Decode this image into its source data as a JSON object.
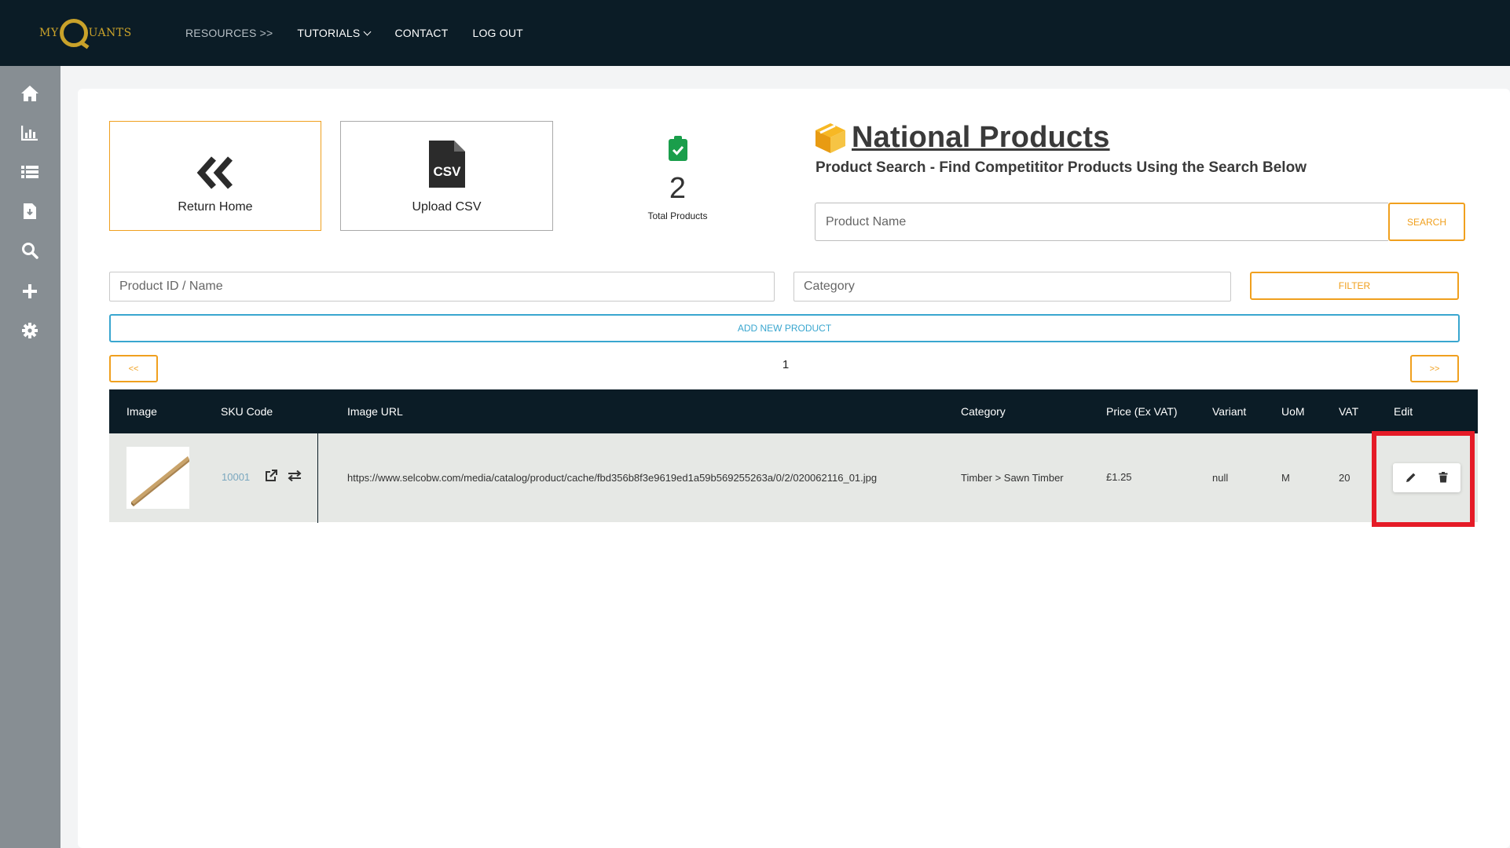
{
  "topbar": {
    "logo": {
      "left": "MY",
      "right": "UANTS"
    },
    "nav": {
      "resources": "RESOURCES >>",
      "tutorials": "TUTORIALS",
      "contact": "CONTACT",
      "logout": "LOG OUT"
    }
  },
  "sidebar": {
    "items": [
      "home-icon",
      "bar-chart-icon",
      "list-icon",
      "document-download-icon",
      "search-icon",
      "plus-icon",
      "gear-icon"
    ]
  },
  "tiles": {
    "return_home": "Return Home",
    "upload_csv": "Upload CSV",
    "csv_badge": "CSV"
  },
  "stats": {
    "total_count": "2",
    "total_label": "Total Products"
  },
  "heading": {
    "title": "National Products",
    "subtitle": "Product Search - Find Competititor Products Using the Search Below"
  },
  "search": {
    "placeholder": "Product Name",
    "button": "SEARCH"
  },
  "filters": {
    "id_placeholder": "Product ID / Name",
    "category_placeholder": "Category",
    "button": "FILTER"
  },
  "add_product": "ADD NEW PRODUCT",
  "pagination": {
    "prev": "<<",
    "next": ">>",
    "current": "1"
  },
  "table": {
    "headers": {
      "image": "Image",
      "sku": "SKU Code",
      "url": "Image URL",
      "category": "Category",
      "price": "Price (Ex VAT)",
      "variant": "Variant",
      "uom": "UoM",
      "vat": "VAT",
      "edit": "Edit"
    },
    "rows": [
      {
        "sku": "10001",
        "url": "https://www.selcobw.com/media/catalog/product/cache/fbd356b8f3e9619ed1a59b569255263a/0/2/020062116_01.jpg",
        "category": "Timber > Sawn Timber",
        "price": "£1.25",
        "variant": "null",
        "uom": "M",
        "vat": "20"
      }
    ]
  },
  "colors": {
    "navy": "#0b1c26",
    "accent": "#f0a01e",
    "link": "#39a6cf",
    "highlight": "#e51b27",
    "check_green": "#1a9e4b"
  }
}
